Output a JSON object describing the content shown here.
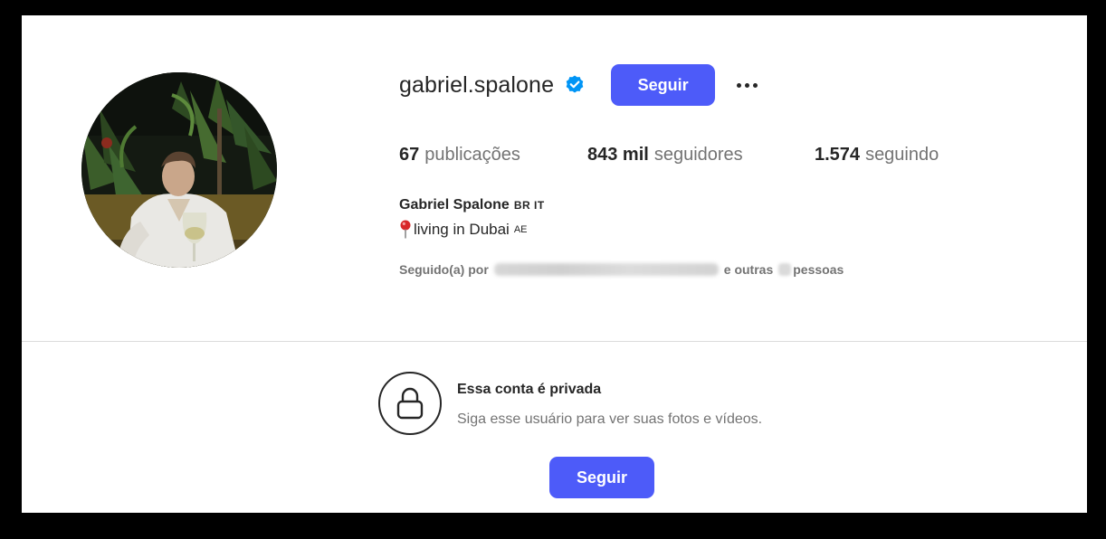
{
  "profile": {
    "username": "gabriel.spalone",
    "verified_icon": "verified-badge-icon",
    "follow_label": "Seguir",
    "more_icon": "more-options-icon",
    "stats": {
      "posts_count": "67",
      "posts_label": "publicações",
      "followers_count": "843 mil",
      "followers_label": "seguidores",
      "following_count": "1.574",
      "following_label": "seguindo"
    },
    "full_name": "Gabriel Spalone",
    "full_name_flags": "BR IT",
    "bio_icon": "round-pushpin-icon",
    "bio_text": "living in Dubai",
    "bio_flag": "AE",
    "followed_by_prefix": "Seguido(a) por",
    "followed_by_middle": "e outras",
    "followed_by_suffix": "pessoas"
  },
  "private_notice": {
    "icon": "lock-icon",
    "title": "Essa conta é privada",
    "subtitle": "Siga esse usuário para ver suas fotos e vídeos.",
    "follow_label": "Seguir"
  },
  "colors": {
    "accent": "#4d5bf9",
    "verified": "#0095f6",
    "frame_background": "#000000"
  }
}
